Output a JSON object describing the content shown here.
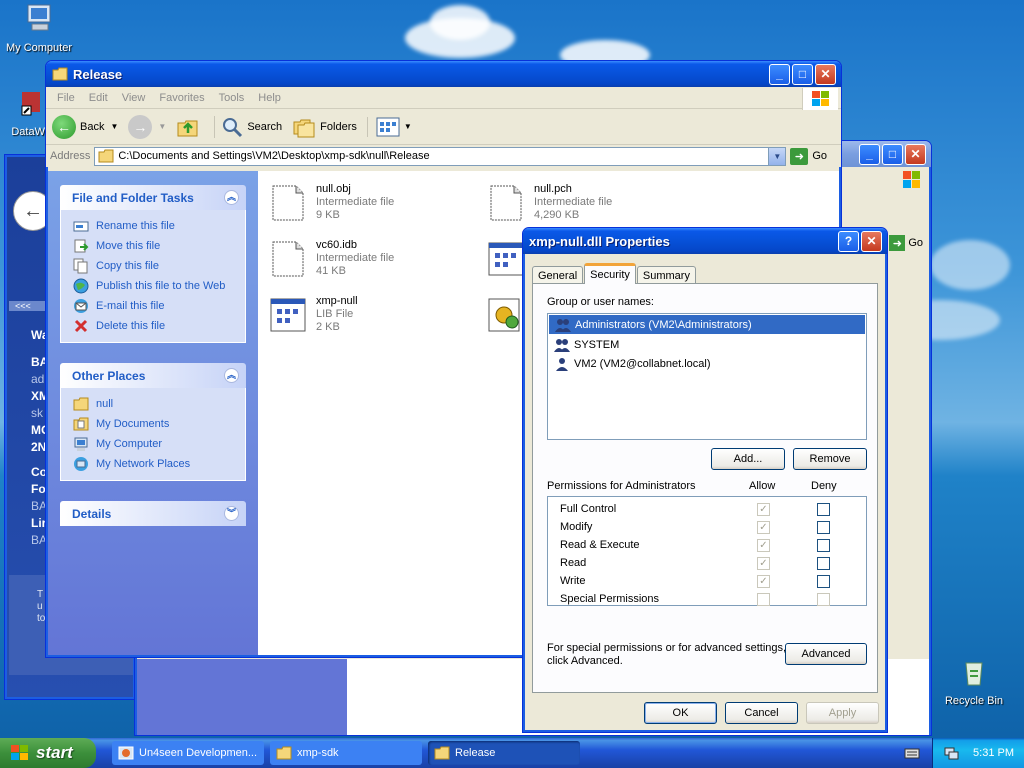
{
  "desktop": {
    "icons": [
      {
        "label": "My Computer"
      },
      {
        "label": "DataWa"
      },
      {
        "label": "Recycle Bin"
      }
    ]
  },
  "background_window": {
    "left_items": [
      "Wa",
      "BA",
      "ad",
      "XM",
      "sk",
      "MO",
      "2N",
      "Co",
      "Fo",
      "BA",
      "Lir",
      "BA",
      "T",
      "u",
      "to"
    ],
    "go_label": "Go"
  },
  "explorer": {
    "title": "Release",
    "menu": [
      "File",
      "Edit",
      "View",
      "Favorites",
      "Tools",
      "Help"
    ],
    "toolbar": {
      "back": "Back",
      "search": "Search",
      "folders": "Folders"
    },
    "address_label": "Address",
    "address_value": "C:\\Documents and Settings\\VM2\\Desktop\\xmp-sdk\\null\\Release",
    "go_label": "Go",
    "file_tasks": {
      "title": "File and Folder Tasks",
      "items": [
        "Rename this file",
        "Move this file",
        "Copy this file",
        "Publish this file to the Web",
        "E-mail this file",
        "Delete this file"
      ]
    },
    "other_places": {
      "title": "Other Places",
      "items": [
        "null",
        "My Documents",
        "My Computer",
        "My Network Places"
      ]
    },
    "details": {
      "title": "Details"
    },
    "files": [
      {
        "name": "null.obj",
        "type": "Intermediate file",
        "size": "9 KB"
      },
      {
        "name": "null.pch",
        "type": "Intermediate file",
        "size": "4,290 KB"
      },
      {
        "name": "vc60.idb",
        "type": "Intermediate file",
        "size": "41 KB"
      },
      {
        "name": "xmp-null",
        "type": "LIB File",
        "size": "2 KB"
      }
    ]
  },
  "dialog": {
    "title": "xmp-null.dll Properties",
    "tabs": [
      "General",
      "Security",
      "Summary"
    ],
    "group_label": "Group or user names:",
    "users": [
      "Administrators (VM2\\Administrators)",
      "SYSTEM",
      "VM2 (VM2@collabnet.local)"
    ],
    "add_button": "Add...",
    "remove_button": "Remove",
    "permissions_label": "Permissions for Administrators",
    "allow_label": "Allow",
    "deny_label": "Deny",
    "permissions": [
      {
        "name": "Full Control",
        "allow": true
      },
      {
        "name": "Modify",
        "allow": true
      },
      {
        "name": "Read & Execute",
        "allow": true
      },
      {
        "name": "Read",
        "allow": true
      },
      {
        "name": "Write",
        "allow": true
      },
      {
        "name": "Special Permissions",
        "allow": false
      }
    ],
    "special_line1": "For special permissions or for advanced settings,",
    "special_line2": "click Advanced.",
    "advanced_button": "Advanced",
    "ok_button": "OK",
    "cancel_button": "Cancel",
    "apply_button": "Apply"
  },
  "taskbar": {
    "start_label": "start",
    "tasks": [
      "Un4seen Developmen...",
      "xmp-sdk",
      "Release"
    ],
    "clock": "5:31 PM"
  }
}
